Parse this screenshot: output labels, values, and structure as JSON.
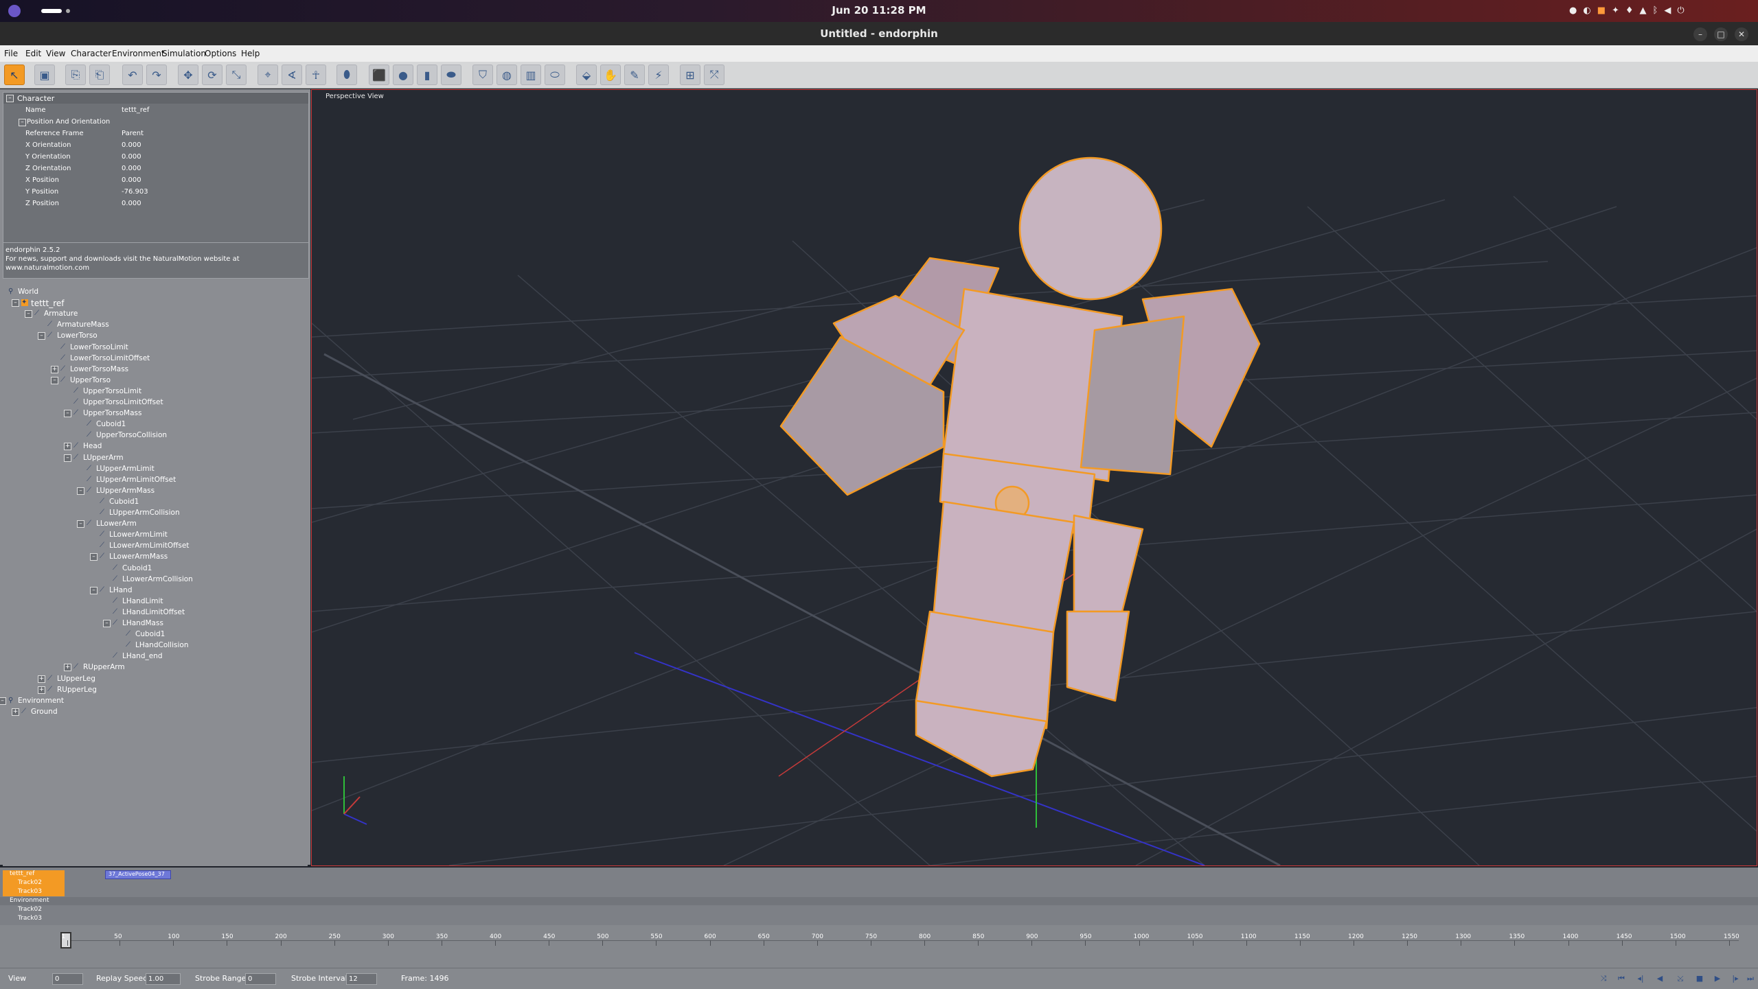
{
  "system": {
    "clock": "Jun 20  11:28 PM"
  },
  "window": {
    "title": "Untitled - endorphin",
    "controls": [
      "minimize-icon",
      "maximize-icon",
      "close-icon"
    ]
  },
  "menu": [
    "File",
    "Edit",
    "View",
    "Character",
    "Environment",
    "Simulation",
    "Options",
    "Help"
  ],
  "properties": {
    "header": "Character",
    "rows": [
      {
        "label": "Name",
        "value": "tettt_ref"
      },
      {
        "label": "Position And Orientation",
        "value": ""
      },
      {
        "label": "Reference Frame",
        "value": "Parent"
      },
      {
        "label": "X Orientation",
        "value": "0.000"
      },
      {
        "label": "Y Orientation",
        "value": "0.000"
      },
      {
        "label": "Z Orientation",
        "value": "0.000"
      },
      {
        "label": "X Position",
        "value": "0.000"
      },
      {
        "label": "Y Position",
        "value": "-76.903"
      },
      {
        "label": "Z Position",
        "value": "0.000"
      }
    ],
    "info_line1": "endorphin 2.5.2",
    "info_line2": "For news, support and downloads visit the NaturalMotion website at",
    "info_line3": "www.naturalmotion.com"
  },
  "tree": [
    {
      "label": "World",
      "level": 0
    },
    {
      "label": "tettt_ref",
      "level": 1
    },
    {
      "label": "Armature",
      "level": 2
    },
    {
      "label": "ArmatureMass",
      "level": 3
    },
    {
      "label": "LowerTorso",
      "level": 3
    },
    {
      "label": "LowerTorsoLimit",
      "level": 4
    },
    {
      "label": "LowerTorsoLimitOffset",
      "level": 4
    },
    {
      "label": "LowerTorsoMass",
      "level": 4
    },
    {
      "label": "UpperTorso",
      "level": 4
    },
    {
      "label": "UpperTorsoLimit",
      "level": 5
    },
    {
      "label": "UpperTorsoLimitOffset",
      "level": 5
    },
    {
      "label": "UpperTorsoMass",
      "level": 5
    },
    {
      "label": "Cuboid1",
      "level": 6
    },
    {
      "label": "UpperTorsoCollision",
      "level": 6
    },
    {
      "label": "Head",
      "level": 5
    },
    {
      "label": "LUpperArm",
      "level": 5
    },
    {
      "label": "LUpperArmLimit",
      "level": 6
    },
    {
      "label": "LUpperArmLimitOffset",
      "level": 6
    },
    {
      "label": "LUpperArmMass",
      "level": 6
    },
    {
      "label": "Cuboid1",
      "level": 7
    },
    {
      "label": "LUpperArmCollision",
      "level": 7
    },
    {
      "label": "LLowerArm",
      "level": 6
    },
    {
      "label": "LLowerArmLimit",
      "level": 7
    },
    {
      "label": "LLowerArmLimitOffset",
      "level": 7
    },
    {
      "label": "LLowerArmMass",
      "level": 7
    },
    {
      "label": "Cuboid1",
      "level": 8
    },
    {
      "label": "LLowerArmCollision",
      "level": 8
    },
    {
      "label": "LHand",
      "level": 7
    },
    {
      "label": "LHandLimit",
      "level": 8
    },
    {
      "label": "LHandLimitOffset",
      "level": 8
    },
    {
      "label": "LHandMass",
      "level": 8
    },
    {
      "label": "Cuboid1",
      "level": 9
    },
    {
      "label": "LHandCollision",
      "level": 9
    },
    {
      "label": "LHand_end",
      "level": 8
    },
    {
      "label": "RUpperArm",
      "level": 5
    },
    {
      "label": "LUpperLeg",
      "level": 3
    },
    {
      "label": "RUpperLeg",
      "level": 3
    },
    {
      "label": "Environment",
      "level": 0
    },
    {
      "label": "Ground",
      "level": 1
    }
  ],
  "viewport": {
    "label": "Perspective View"
  },
  "timeline": {
    "tracks": [
      "tettt_ref",
      "Track02",
      "Track03",
      "Environment",
      "Track02",
      "Track03"
    ],
    "clip_label": "37_ActivePose04_37",
    "ruler_labels": [
      "1",
      "50",
      "100",
      "150",
      "200",
      "250",
      "300",
      "350",
      "400",
      "450",
      "500",
      "550",
      "600",
      "650",
      "700",
      "750",
      "800",
      "850",
      "900",
      "950",
      "1000",
      "1050",
      "1100",
      "1150",
      "1200",
      "1250",
      "1300",
      "1350",
      "1400",
      "1450",
      "1500",
      "1550"
    ]
  },
  "status": {
    "view_label": "View",
    "view_value": "0",
    "replay_label": "Replay Speed:",
    "replay_value": "1.00",
    "strobe_range_label": "Strobe Range:",
    "strobe_range_value": "0",
    "strobe_interval_label": "Strobe Interval:",
    "strobe_interval_value": "12",
    "frame_text": "Frame: 1496"
  },
  "colors": {
    "accent": "#f39a24",
    "body": "#c9b2bf",
    "viewport_border": "#d03c3c"
  }
}
